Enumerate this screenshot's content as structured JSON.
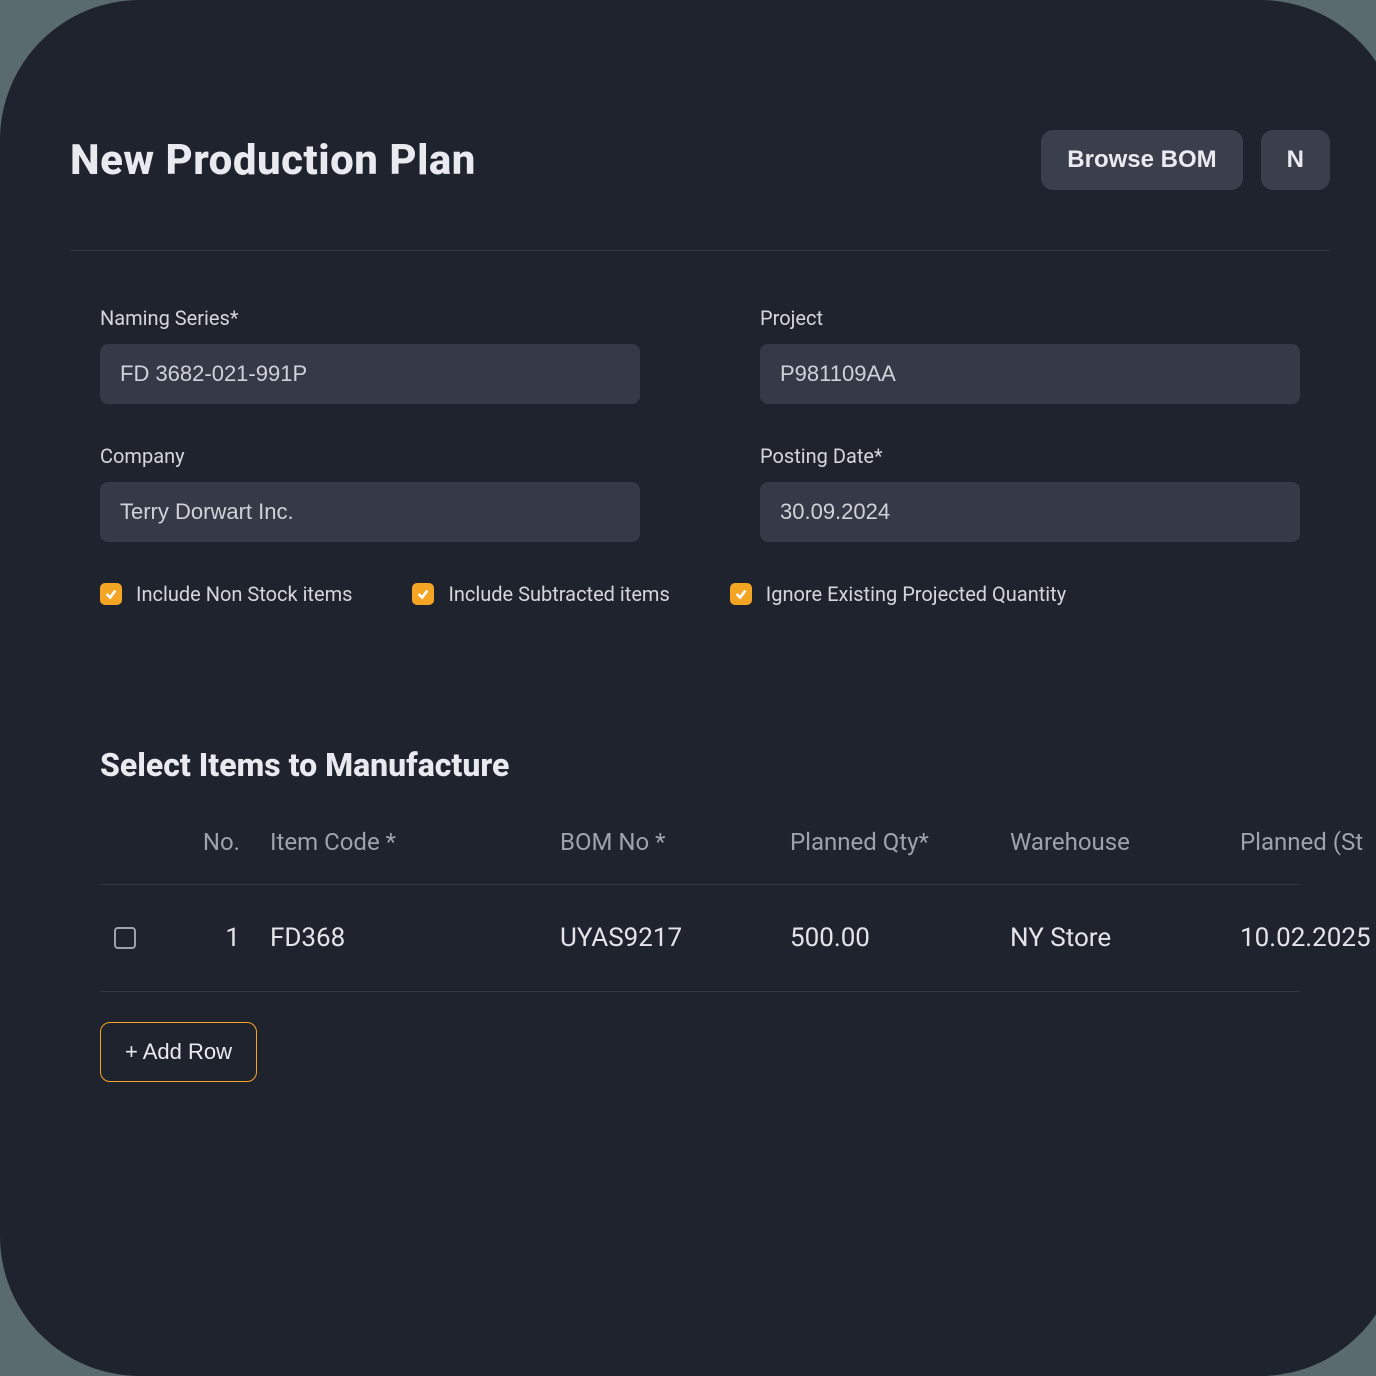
{
  "header": {
    "title": "New Production Plan",
    "browse_bom": "Browse BOM",
    "next": "N"
  },
  "form": {
    "naming_series": {
      "label": "Naming Series*",
      "value": "FD 3682-021-991P"
    },
    "project": {
      "label": "Project",
      "value": "P981109AA"
    },
    "company": {
      "label": "Company",
      "value": "Terry Dorwart Inc."
    },
    "posting_date": {
      "label": "Posting Date*",
      "value": "30.09.2024"
    }
  },
  "checks": {
    "non_stock": "Include Non Stock items",
    "subtracted": "Include Subtracted items",
    "ignore_proj": "Ignore Existing Projected Quantity"
  },
  "items_section": {
    "title": "Select Items to Manufacture",
    "columns": {
      "no": "No.",
      "item_code": "Item Code *",
      "bom_no": "BOM No *",
      "planned_qty": "Planned Qty*",
      "warehouse": "Warehouse",
      "planned_start": "Planned (St"
    },
    "rows": [
      {
        "no": "1",
        "item_code": "FD368",
        "bom_no": "UYAS9217",
        "planned_qty": "500.00",
        "warehouse": "NY Store",
        "planned_start": "10.02.2025"
      }
    ],
    "add_row": "+ Add Row"
  }
}
